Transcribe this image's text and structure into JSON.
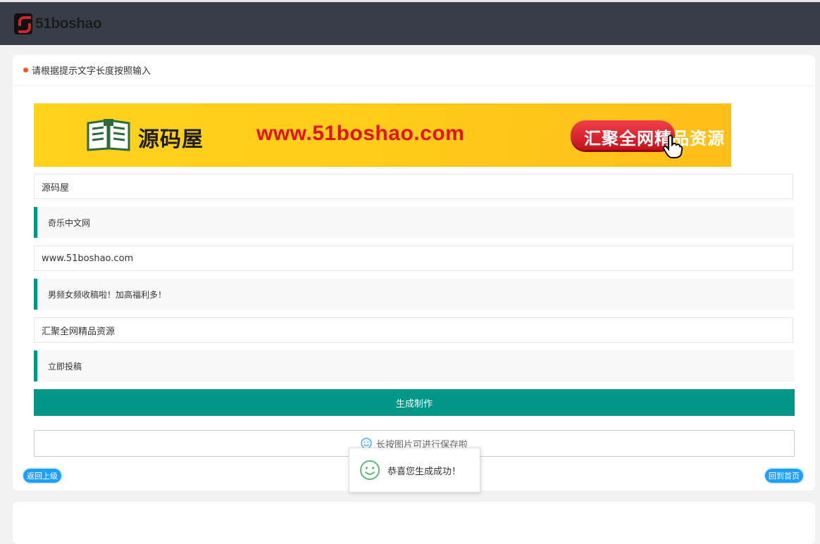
{
  "header": {
    "logo_text": "51boshao",
    "logo_icon": "brand-s-logo",
    "bg_color": "#393d49"
  },
  "card": {
    "title": "请根据提示文字长度按照输入",
    "dot_color": "#ff5722"
  },
  "banner": {
    "name": "源码屋",
    "url": "www.51boshao.com",
    "slogan": "汇聚全网精品资源",
    "icon": "book-icon"
  },
  "form": {
    "field1_value": "源码屋",
    "hint1": "奇乐中文网",
    "field2_value": "www.51boshao.com",
    "hint2": "男频女频收稿啦！加高福利多！",
    "field3_value": "汇聚全网精品资源",
    "hint3": "立即投稿",
    "accent_color": "#009688"
  },
  "generate_button": {
    "label": "生成制作"
  },
  "result": {
    "message": "长按图片可进行保存啦",
    "icon": "smile-icon"
  },
  "nav": {
    "back_label": "返回上级",
    "home_label": "回到首页",
    "color": "#1e9fff"
  },
  "toast": {
    "message": "恭喜您生成成功！",
    "icon": "smile-icon",
    "icon_color": "#5fb878"
  }
}
